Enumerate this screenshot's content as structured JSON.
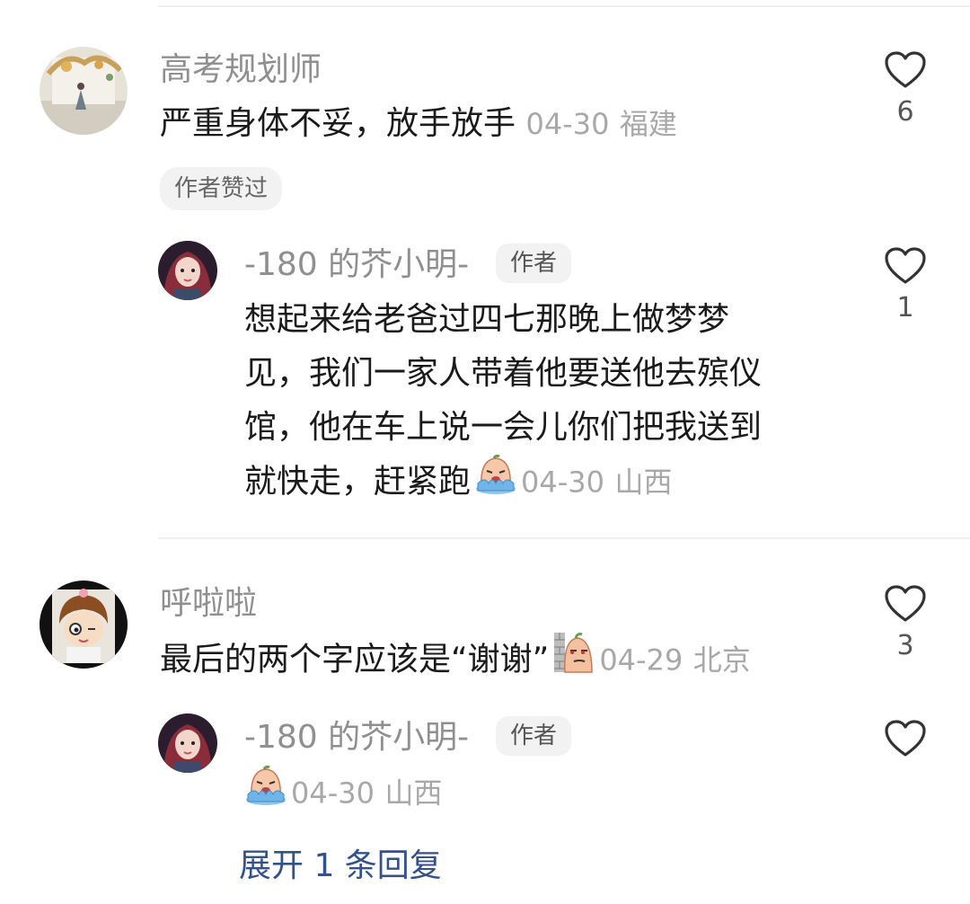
{
  "comments": [
    {
      "username": "高考规划师",
      "text": "严重身体不妥，放手放手",
      "date": "04-30",
      "location": "福建",
      "badge": "作者赞过",
      "likes": "6",
      "reply": {
        "username": "-180 的芥小明-",
        "author_tag": "作者",
        "text_lines": [
          "想起来给老爸过四七那晚上做梦梦",
          "见，我们一家人带着他要送他去殡仪",
          "馆，他在车上说一会儿你们把我送到",
          "就快走，赶紧跑"
        ],
        "emoji": "crying-face-emoji",
        "date": "04-30",
        "location": "山西",
        "likes": "1"
      }
    },
    {
      "username": "呼啦啦",
      "text": "最后的两个字应该是“谢谢”",
      "emoji": "peeking-face-emoji",
      "date": "04-29",
      "location": "北京",
      "likes": "3",
      "reply": {
        "username": "-180 的芥小明-",
        "author_tag": "作者",
        "emoji": "crying-face-emoji",
        "date": "04-30",
        "location": "山西",
        "likes": ""
      },
      "expand_label": "展开 1 条回复"
    }
  ],
  "colors": {
    "name": "#8f8f8f",
    "meta": "#a8a8a8",
    "link": "#33528c",
    "divider": "#efefef"
  }
}
